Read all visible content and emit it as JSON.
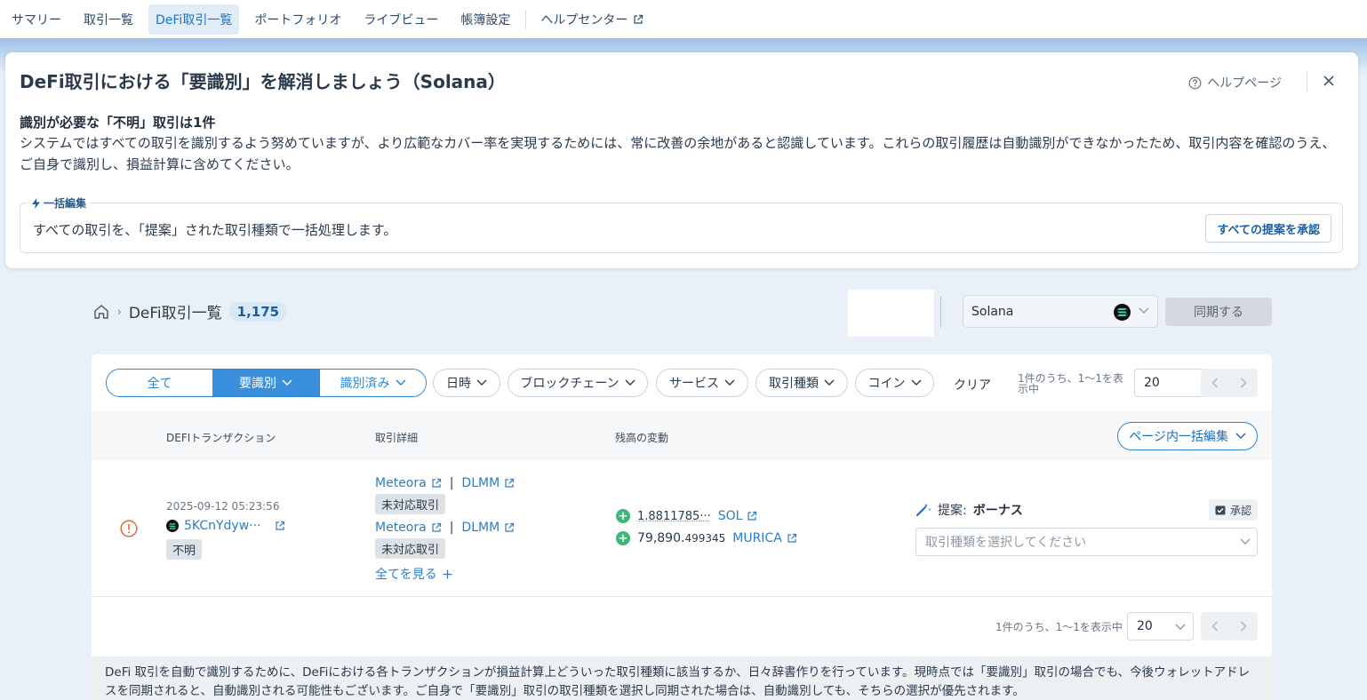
{
  "nav": {
    "items": [
      "サマリー",
      "取引一覧",
      "DeFi取引一覧",
      "ポートフォリオ",
      "ライブビュー",
      "帳簿設定"
    ],
    "active_index": 2,
    "help": "ヘルプセンター"
  },
  "notice": {
    "title": "DeFi取引における「要識別」を解消しましょう（Solana）",
    "help_link": "ヘルプページ",
    "subtitle": "識別が必要な「不明」取引は1件",
    "body": "システムではすべての取引を識別するよう努めていますが、より広範なカバー率を実現するためには、常に改善の余地があると認識しています。これらの取引履歴は自動識別ができなかったため、取引内容を確認のうえ、ご自身で識別し、損益計算に含めてください。",
    "bulk_tag": "一括編集",
    "bulk_text": "すべての取引を、「提案」された取引種類で一括処理します。",
    "approve_all": "すべての提案を承認"
  },
  "breadcrumb": {
    "title": "DeFi取引一覧",
    "count": "1,175"
  },
  "chain": {
    "selected": "Solana",
    "sync": "同期する"
  },
  "filters": {
    "segments": [
      "全て",
      "要識別",
      "識別済み"
    ],
    "active_segment": 1,
    "dropdowns": [
      "日時",
      "ブロックチェーン",
      "サービス",
      "取引種類",
      "コイン"
    ],
    "clear": "クリア"
  },
  "pagination": {
    "top_info": "1件のうち、1〜1を表示中",
    "top_info_line1": "1件のうち、1〜1を表",
    "top_info_line2": "示中",
    "per_page": "20",
    "bottom_info": "1件のうち、1〜1を表示中"
  },
  "table": {
    "headers": [
      "DEFIトランザクション",
      "取引詳細",
      "残高の変動"
    ],
    "page_bulk": "ページ内一括編集",
    "row": {
      "date": "2025-09-12 05:23:56",
      "hash": "5KCnYdyw···",
      "status": "不明",
      "details": [
        {
          "service": "Meteora",
          "pool": "DLMM",
          "tag": "未対応取引"
        },
        {
          "service": "Meteora",
          "pool": "DLMM",
          "tag": "未対応取引"
        }
      ],
      "see_all": "全てを見る",
      "balances": [
        {
          "amount_main": "1.8811785···",
          "amount_small": "",
          "coin": "SOL"
        },
        {
          "amount_main": "79,890.",
          "amount_small": "499345",
          "coin": "MURICA"
        }
      ],
      "suggest_label": "提案:",
      "suggest_value": "ボーナス",
      "approve": "承認",
      "type_placeholder": "取引種類を選択してください"
    }
  },
  "footer_note": "DeFi 取引を自動で識別するために、DeFiにおける各トランザクションが損益計算上どういった取引種類に該当するか、日々辞書作りを行っています。現時点では「要識別」取引の場合でも、今後ウォレットアドレスを同期されると、自動識別される可能性もございます。ご自身で「要識別」取引の取引種類を選択し同期された場合は、自動識別しても、そちらの選択が優先されます。",
  "colors": {
    "accent": "#2e85d0",
    "active_segment": "#3a8fdc",
    "success": "#3cb878",
    "warning": "#e0673a"
  }
}
